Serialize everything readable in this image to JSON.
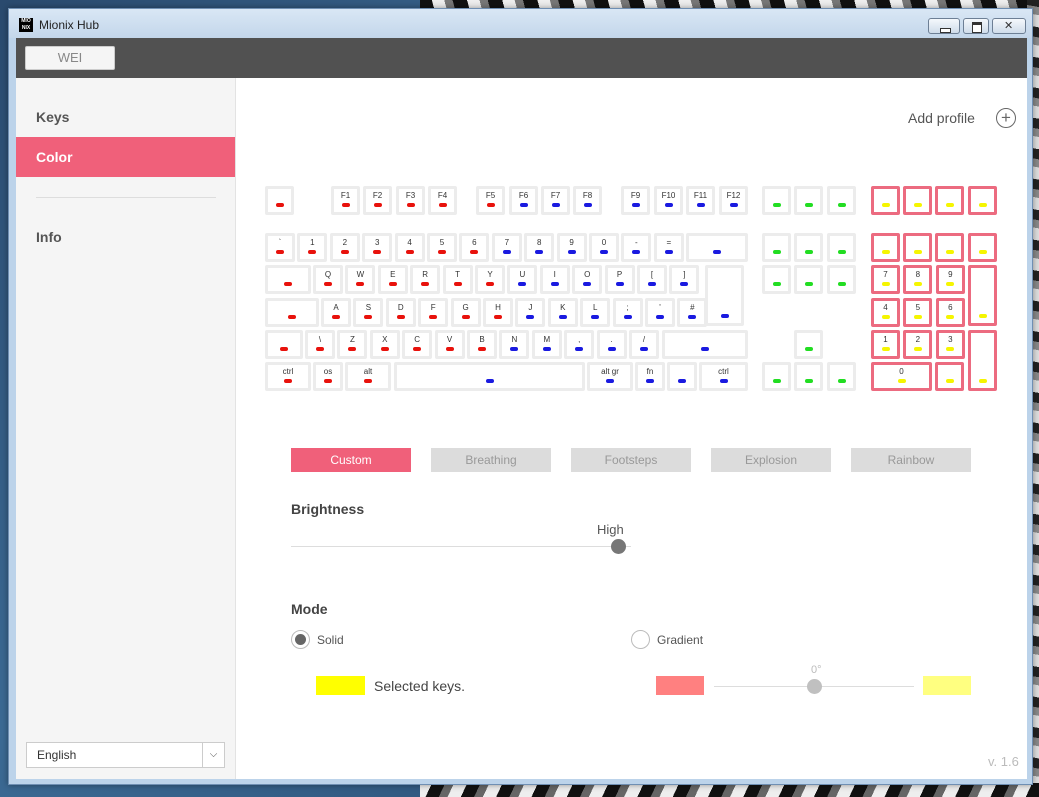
{
  "window": {
    "title": "Mionix Hub",
    "icon_text": "MIO NIX"
  },
  "profile": {
    "tab_label": "WEI"
  },
  "sidebar": {
    "items": [
      {
        "label": "Keys"
      },
      {
        "label": "Color"
      },
      {
        "label": "Info"
      }
    ],
    "language": "English"
  },
  "main": {
    "add_profile_label": "Add profile",
    "effects": [
      "Custom",
      "Breathing",
      "Footsteps",
      "Explosion",
      "Rainbow"
    ],
    "brightness": {
      "title": "Brightness",
      "value_label": "High",
      "level": 1.0
    },
    "mode": {
      "title": "Mode",
      "solid_label": "Solid",
      "gradient_label": "Gradient",
      "selected_keys_label": "Selected keys.",
      "angle_label": "0°",
      "angle_level": 0.5
    },
    "version": "v. 1.6"
  },
  "colors": {
    "accent": "#f0607a",
    "led_red": "#e8120c",
    "led_blue": "#1a1ae0",
    "led_green": "#22dd22",
    "led_yellow": "#f5f500",
    "solid_color": "#ffff00",
    "gradient_start": "#ff8080",
    "gradient_end": "#ffff80",
    "slider_knob": "#777777",
    "gradient_knob": "#c0c0c0"
  },
  "keys": {
    "fn_row": [
      "F1",
      "F2",
      "F3",
      "F4",
      "F5",
      "F6",
      "F7",
      "F8",
      "F9",
      "F10",
      "F11",
      "F12"
    ],
    "number_row": [
      "`",
      "1",
      "2",
      "3",
      "4",
      "5",
      "6",
      "7",
      "8",
      "9",
      "0",
      "-",
      "="
    ],
    "q_row": [
      "Q",
      "W",
      "E",
      "R",
      "T",
      "Y",
      "U",
      "I",
      "O",
      "P",
      "[",
      "]"
    ],
    "a_row": [
      "A",
      "S",
      "D",
      "F",
      "G",
      "H",
      "J",
      "K",
      "L",
      ";",
      "'",
      "#"
    ],
    "z_row": [
      "\\",
      "Z",
      "X",
      "C",
      "V",
      "B",
      "N",
      "M",
      ",",
      ".",
      "/"
    ],
    "bottom_row": [
      "ctrl",
      "os",
      "alt",
      "alt gr",
      "fn",
      "ctrl"
    ],
    "numpad_row1": [
      "7",
      "8",
      "9"
    ],
    "numpad_row2": [
      "4",
      "5",
      "6"
    ],
    "numpad_row3": [
      "1",
      "2",
      "3"
    ],
    "numpad_zero": "0"
  }
}
